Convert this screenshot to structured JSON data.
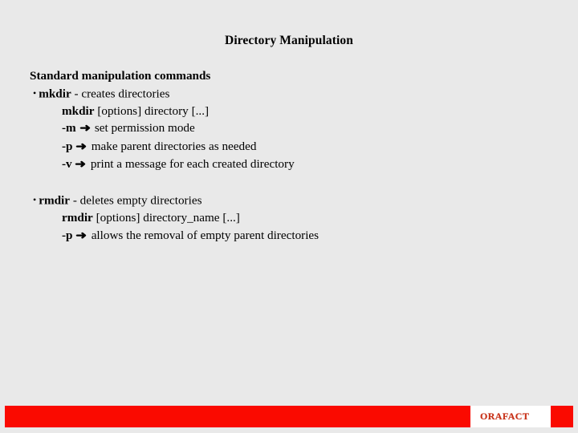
{
  "slide": {
    "title": "Directory Manipulation",
    "background_color": "#e9e9e9",
    "heading": "Standard manipulation commands",
    "bullets": [
      {
        "marker": "•",
        "command": "mkdir",
        "description": " - creates directories",
        "syntax_command": "mkdir",
        "syntax_rest": " [options] directory [...]",
        "options": [
          {
            "flag": "-m",
            "arrow": "➜",
            "text": "set permission mode"
          },
          {
            "flag": "-p",
            "arrow": "➜",
            "text": "make parent directories as needed"
          },
          {
            "flag": "-v",
            "arrow": "➜",
            "text": "print a message for each created directory"
          }
        ]
      },
      {
        "marker": "•",
        "command": "rmdir",
        "description": " - deletes empty directories",
        "syntax_command": "rmdir",
        "syntax_rest": " [options] directory_name [...]",
        "options": [
          {
            "flag": "-p",
            "arrow": "➜",
            "text": "allows the removal of empty parent directories"
          }
        ]
      }
    ]
  },
  "footer": {
    "bar_color": "#fa0a00",
    "logo_text": "ORAFACT",
    "logo_text_color": "#c8331a",
    "logo_background": "#ffffff"
  }
}
